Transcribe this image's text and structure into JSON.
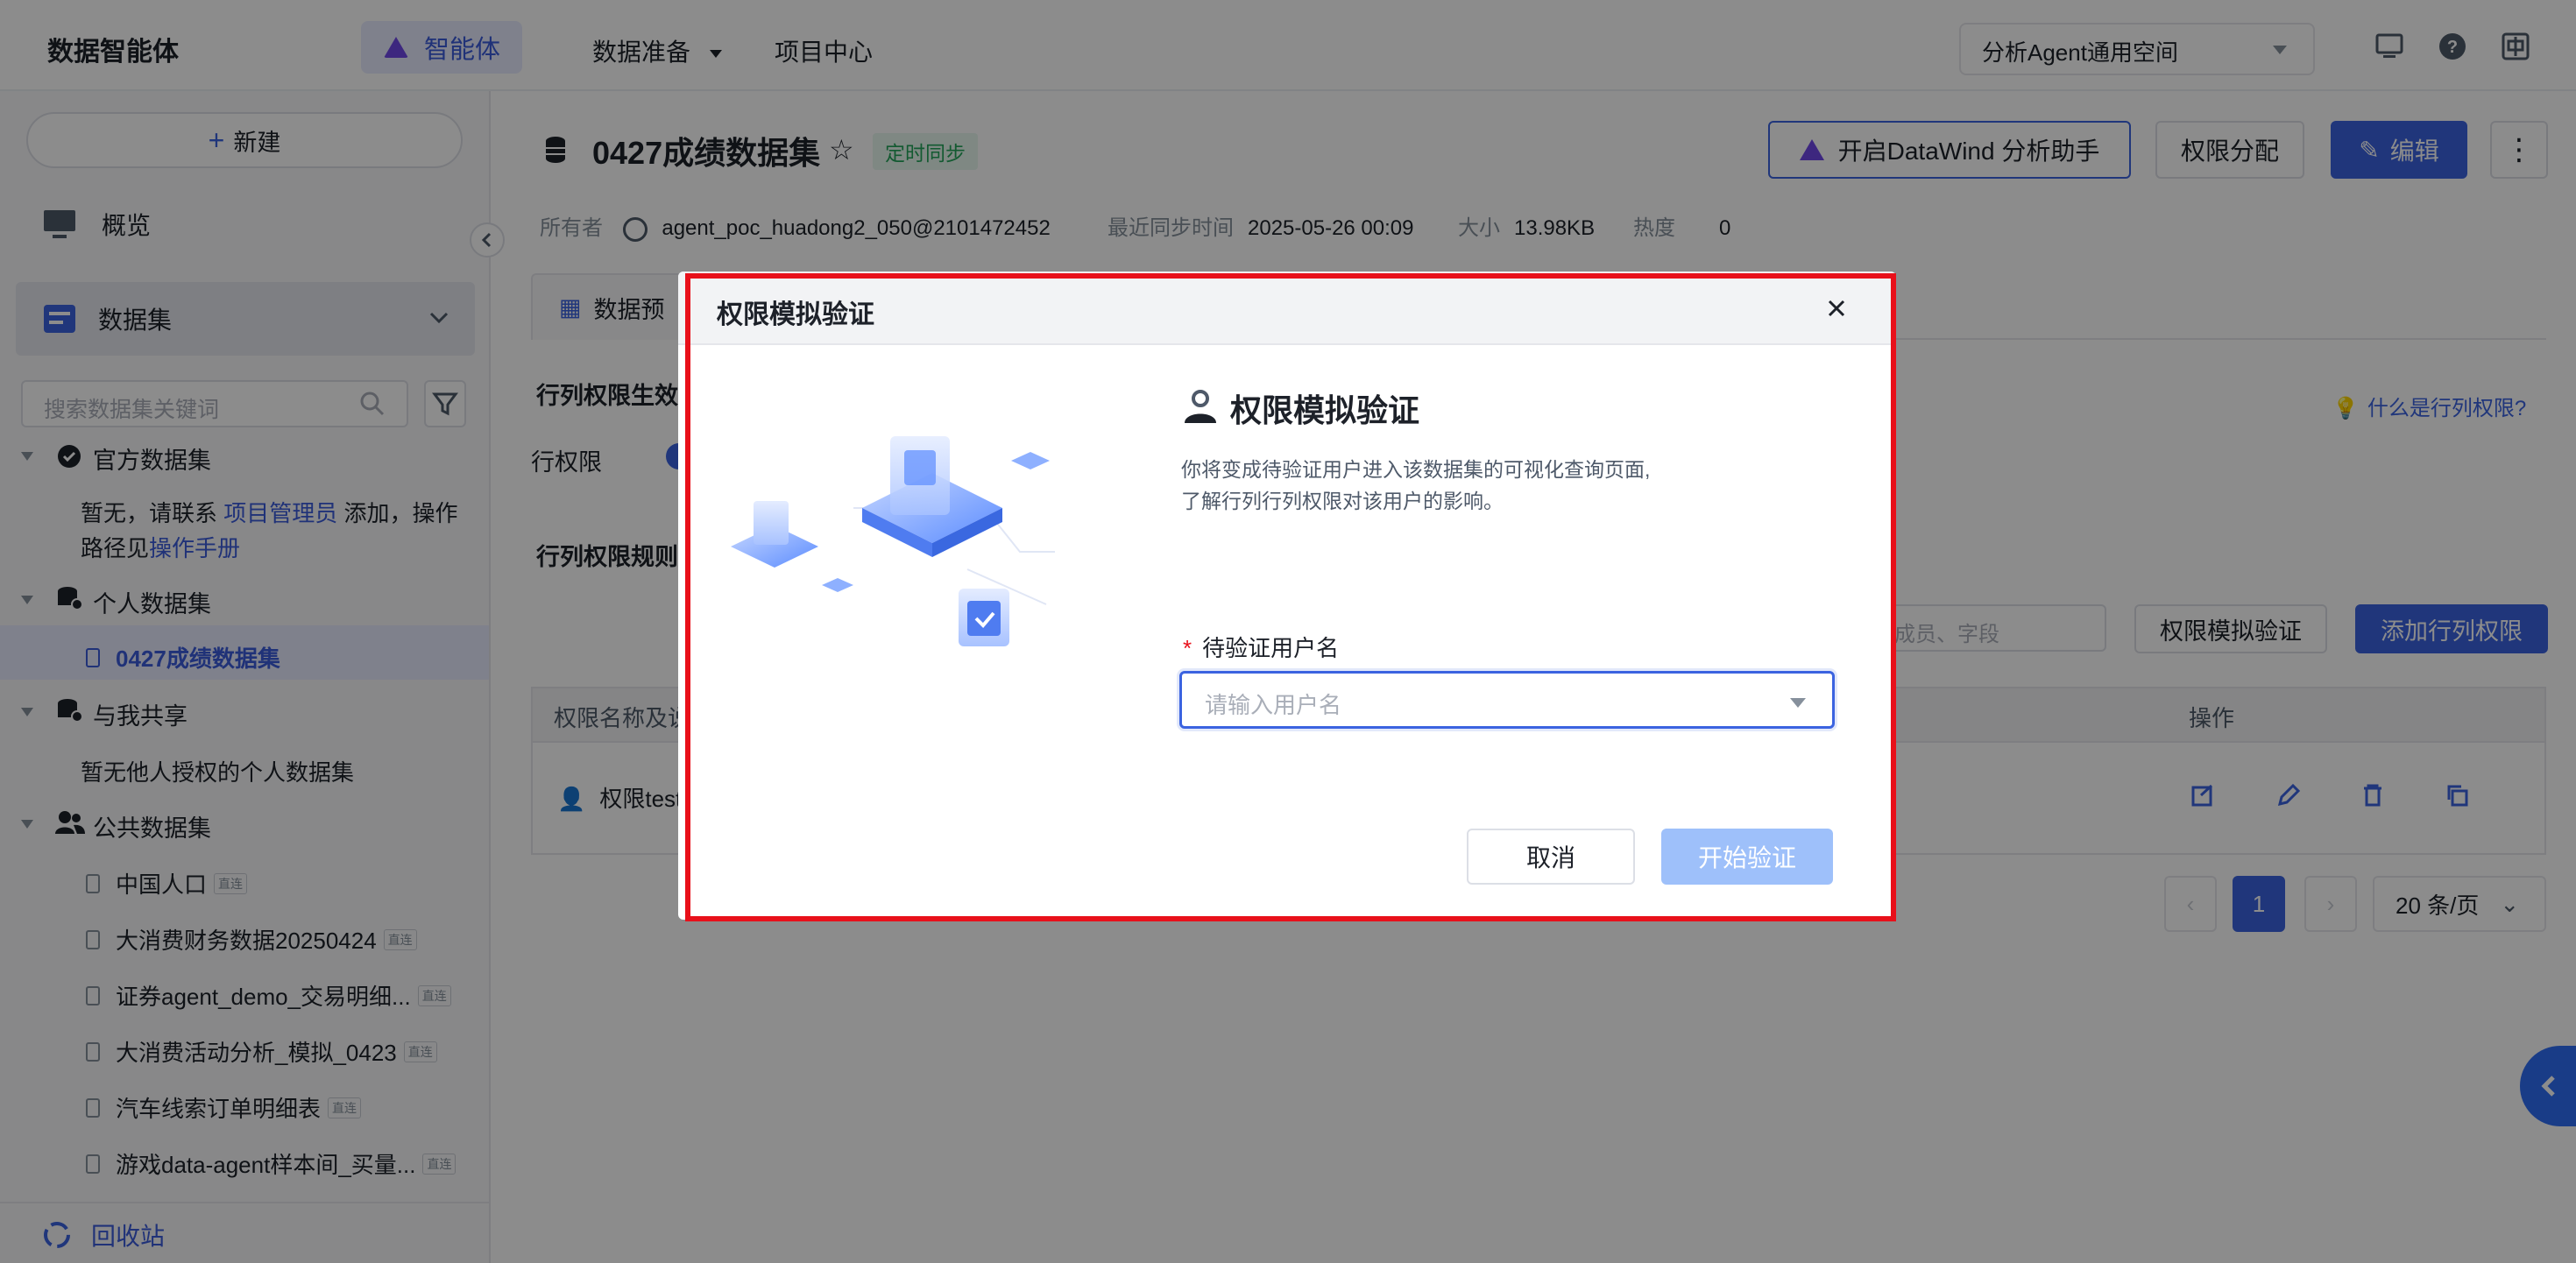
{
  "header": {
    "logo": "数据智能体",
    "nav": {
      "agent": "智能体",
      "data_prep": "数据准备",
      "project_center": "项目中心"
    },
    "workspace": "分析Agent通用空间"
  },
  "sidebar": {
    "new_label": "新建",
    "overview": "概览",
    "dataset": "数据集",
    "search_placeholder": "搜索数据集关键词",
    "official": {
      "title": "官方数据集",
      "empty_text_1": "暂无，请联系",
      "empty_link_1": "项目管理员",
      "empty_text_2": "添加，操作",
      "empty_text_3": "路径见",
      "empty_link_2": "操作手册"
    },
    "personal": {
      "title": "个人数据集",
      "items": [
        "0427成绩数据集"
      ]
    },
    "shared": {
      "title": "与我共享",
      "empty": "暂无他人授权的个人数据集"
    },
    "public": {
      "title": "公共数据集",
      "items": [
        {
          "name": "中国人口",
          "tag": "直连"
        },
        {
          "name": "大消费财务数据20250424",
          "tag": "直连"
        },
        {
          "name": "证券agent_demo_交易明细...",
          "tag": "直连"
        },
        {
          "name": "大消费活动分析_模拟_0423",
          "tag": "直连"
        },
        {
          "name": "汽车线索订单明细表",
          "tag": "直连"
        },
        {
          "name": "游戏data-agent样本间_买量...",
          "tag": "直连"
        }
      ]
    },
    "recycle": "回收站"
  },
  "main": {
    "title": "0427成绩数据集",
    "sync_tag": "定时同步",
    "meta": {
      "owner_label": "所有者",
      "owner": "agent_poc_huadong2_050@2101472452",
      "sync_label": "最近同步时间",
      "sync_time": "2025-05-26 00:09",
      "size_label": "大小",
      "size": "13.98KB",
      "heat_label": "热度",
      "heat": "0"
    },
    "buttons": {
      "datawind": "开启DataWind 分析助手",
      "permission": "权限分配",
      "edit": "编辑"
    },
    "tab_preview": "数据预",
    "section_effect": "行列权限生效",
    "row_perm": "行权限",
    "section_rules": "行列权限规则",
    "help_link": "什么是行列权限?",
    "search_placeholder": "成员、字段",
    "btn_simulate": "权限模拟验证",
    "btn_add": "添加行列权限",
    "table": {
      "col_name": "权限名称及说",
      "col_ops": "操作",
      "row_name": "权限test"
    },
    "pager": {
      "current": "1",
      "page_size": "20 条/页"
    }
  },
  "modal": {
    "title": "权限模拟验证",
    "heading": "权限模拟验证",
    "desc_1": "你将变成待验证用户进入该数据集的可视化查询页面,",
    "desc_2": "了解行列行列权限对该用户的影响。",
    "field_label": "待验证用户名",
    "input_placeholder": "请输入用户名",
    "cancel": "取消",
    "start": "开始验证"
  }
}
